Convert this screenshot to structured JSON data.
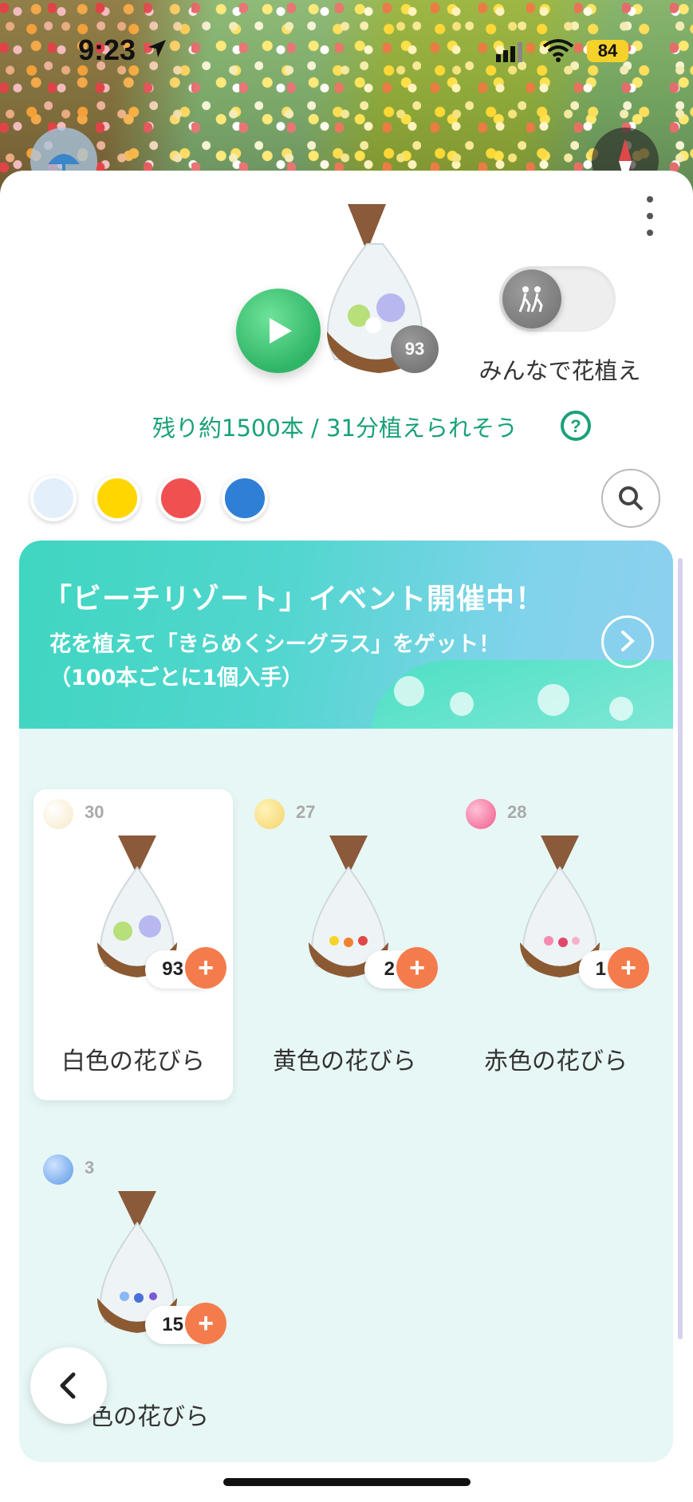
{
  "status_bar": {
    "time": "9:23",
    "battery": "84",
    "icons": [
      "location-arrow-icon",
      "signal-icon",
      "wifi-icon",
      "battery-icon"
    ]
  },
  "map_controls": {
    "weather_icon": "umbrella-icon",
    "compass_icon": "compass-icon"
  },
  "header": {
    "more_icon": "more-vertical-icon",
    "play_icon": "play-icon",
    "selected_count": "93",
    "toggle_label": "みんなで花植え",
    "toggle_icon": "group-walking-icon",
    "remaining_text": "残り約1500本 / 31分植えられそう",
    "help_icon": "question-circle-icon"
  },
  "color_filters": {
    "colors": [
      "#e3effb",
      "#ffd600",
      "#f05050",
      "#2f7fd6"
    ],
    "search_icon": "search-icon"
  },
  "banner": {
    "title": "「ビーチリゾート」イベント開催中！",
    "line1": "花を植えて「きらめくシーグラス」をゲット！",
    "line2": "（100本ごとに1個入手）",
    "arrow_icon": "chevron-right-icon"
  },
  "petals": [
    {
      "stock": "30",
      "quantity": "93",
      "name": "白色の花びら",
      "orb_color": "#f7e9c8",
      "selected": true
    },
    {
      "stock": "27",
      "quantity": "2",
      "name": "黄色の花びら",
      "orb_color": "#f5d46a",
      "selected": false
    },
    {
      "stock": "28",
      "quantity": "1",
      "name": "赤色の花びら",
      "orb_color": "#f05a8a",
      "selected": false
    },
    {
      "stock": "3",
      "quantity": "15",
      "name": "色の花びら",
      "orb_color": "#5a98e6",
      "selected": false
    }
  ],
  "plus_label": "+",
  "back_icon": "chevron-left-icon"
}
